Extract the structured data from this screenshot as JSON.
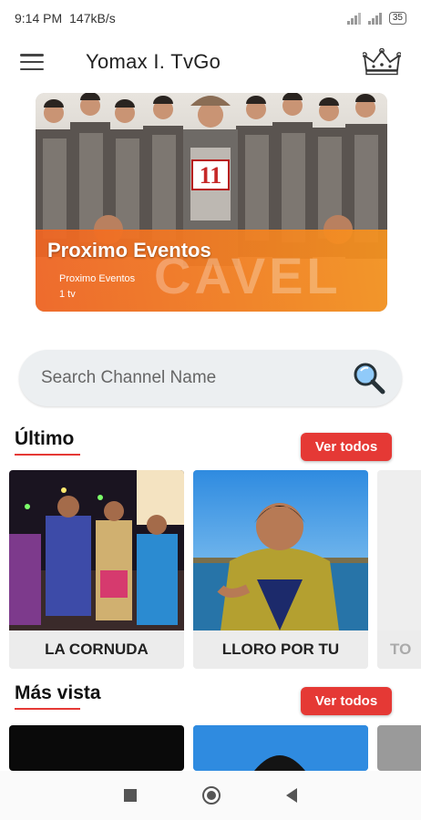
{
  "status_bar": {
    "time": "9:14 PM",
    "speed": "147kB/s",
    "battery": "35"
  },
  "app_bar": {
    "title": "Yomax I. TvGo",
    "menu_icon": "hamburger-icon",
    "premium_icon": "crown-icon"
  },
  "banner": {
    "title": "Proximo Eventos",
    "subtitle": "Proximo Eventos",
    "caption": "1 tv",
    "badge_text": "11",
    "overlay_text": "CAVEL"
  },
  "search": {
    "placeholder": "Search Channel Name",
    "icon": "search-icon"
  },
  "sections": [
    {
      "title": "Último",
      "button": "Ver todos",
      "items": [
        "LA CORNUDA",
        "LLORO POR TU",
        "TO"
      ]
    },
    {
      "title": "Más vista",
      "button": "Ver todos"
    }
  ],
  "colors": {
    "accent": "#e53935",
    "banner_orange": "#f06a1f",
    "card_label_bg": "#ececec"
  }
}
